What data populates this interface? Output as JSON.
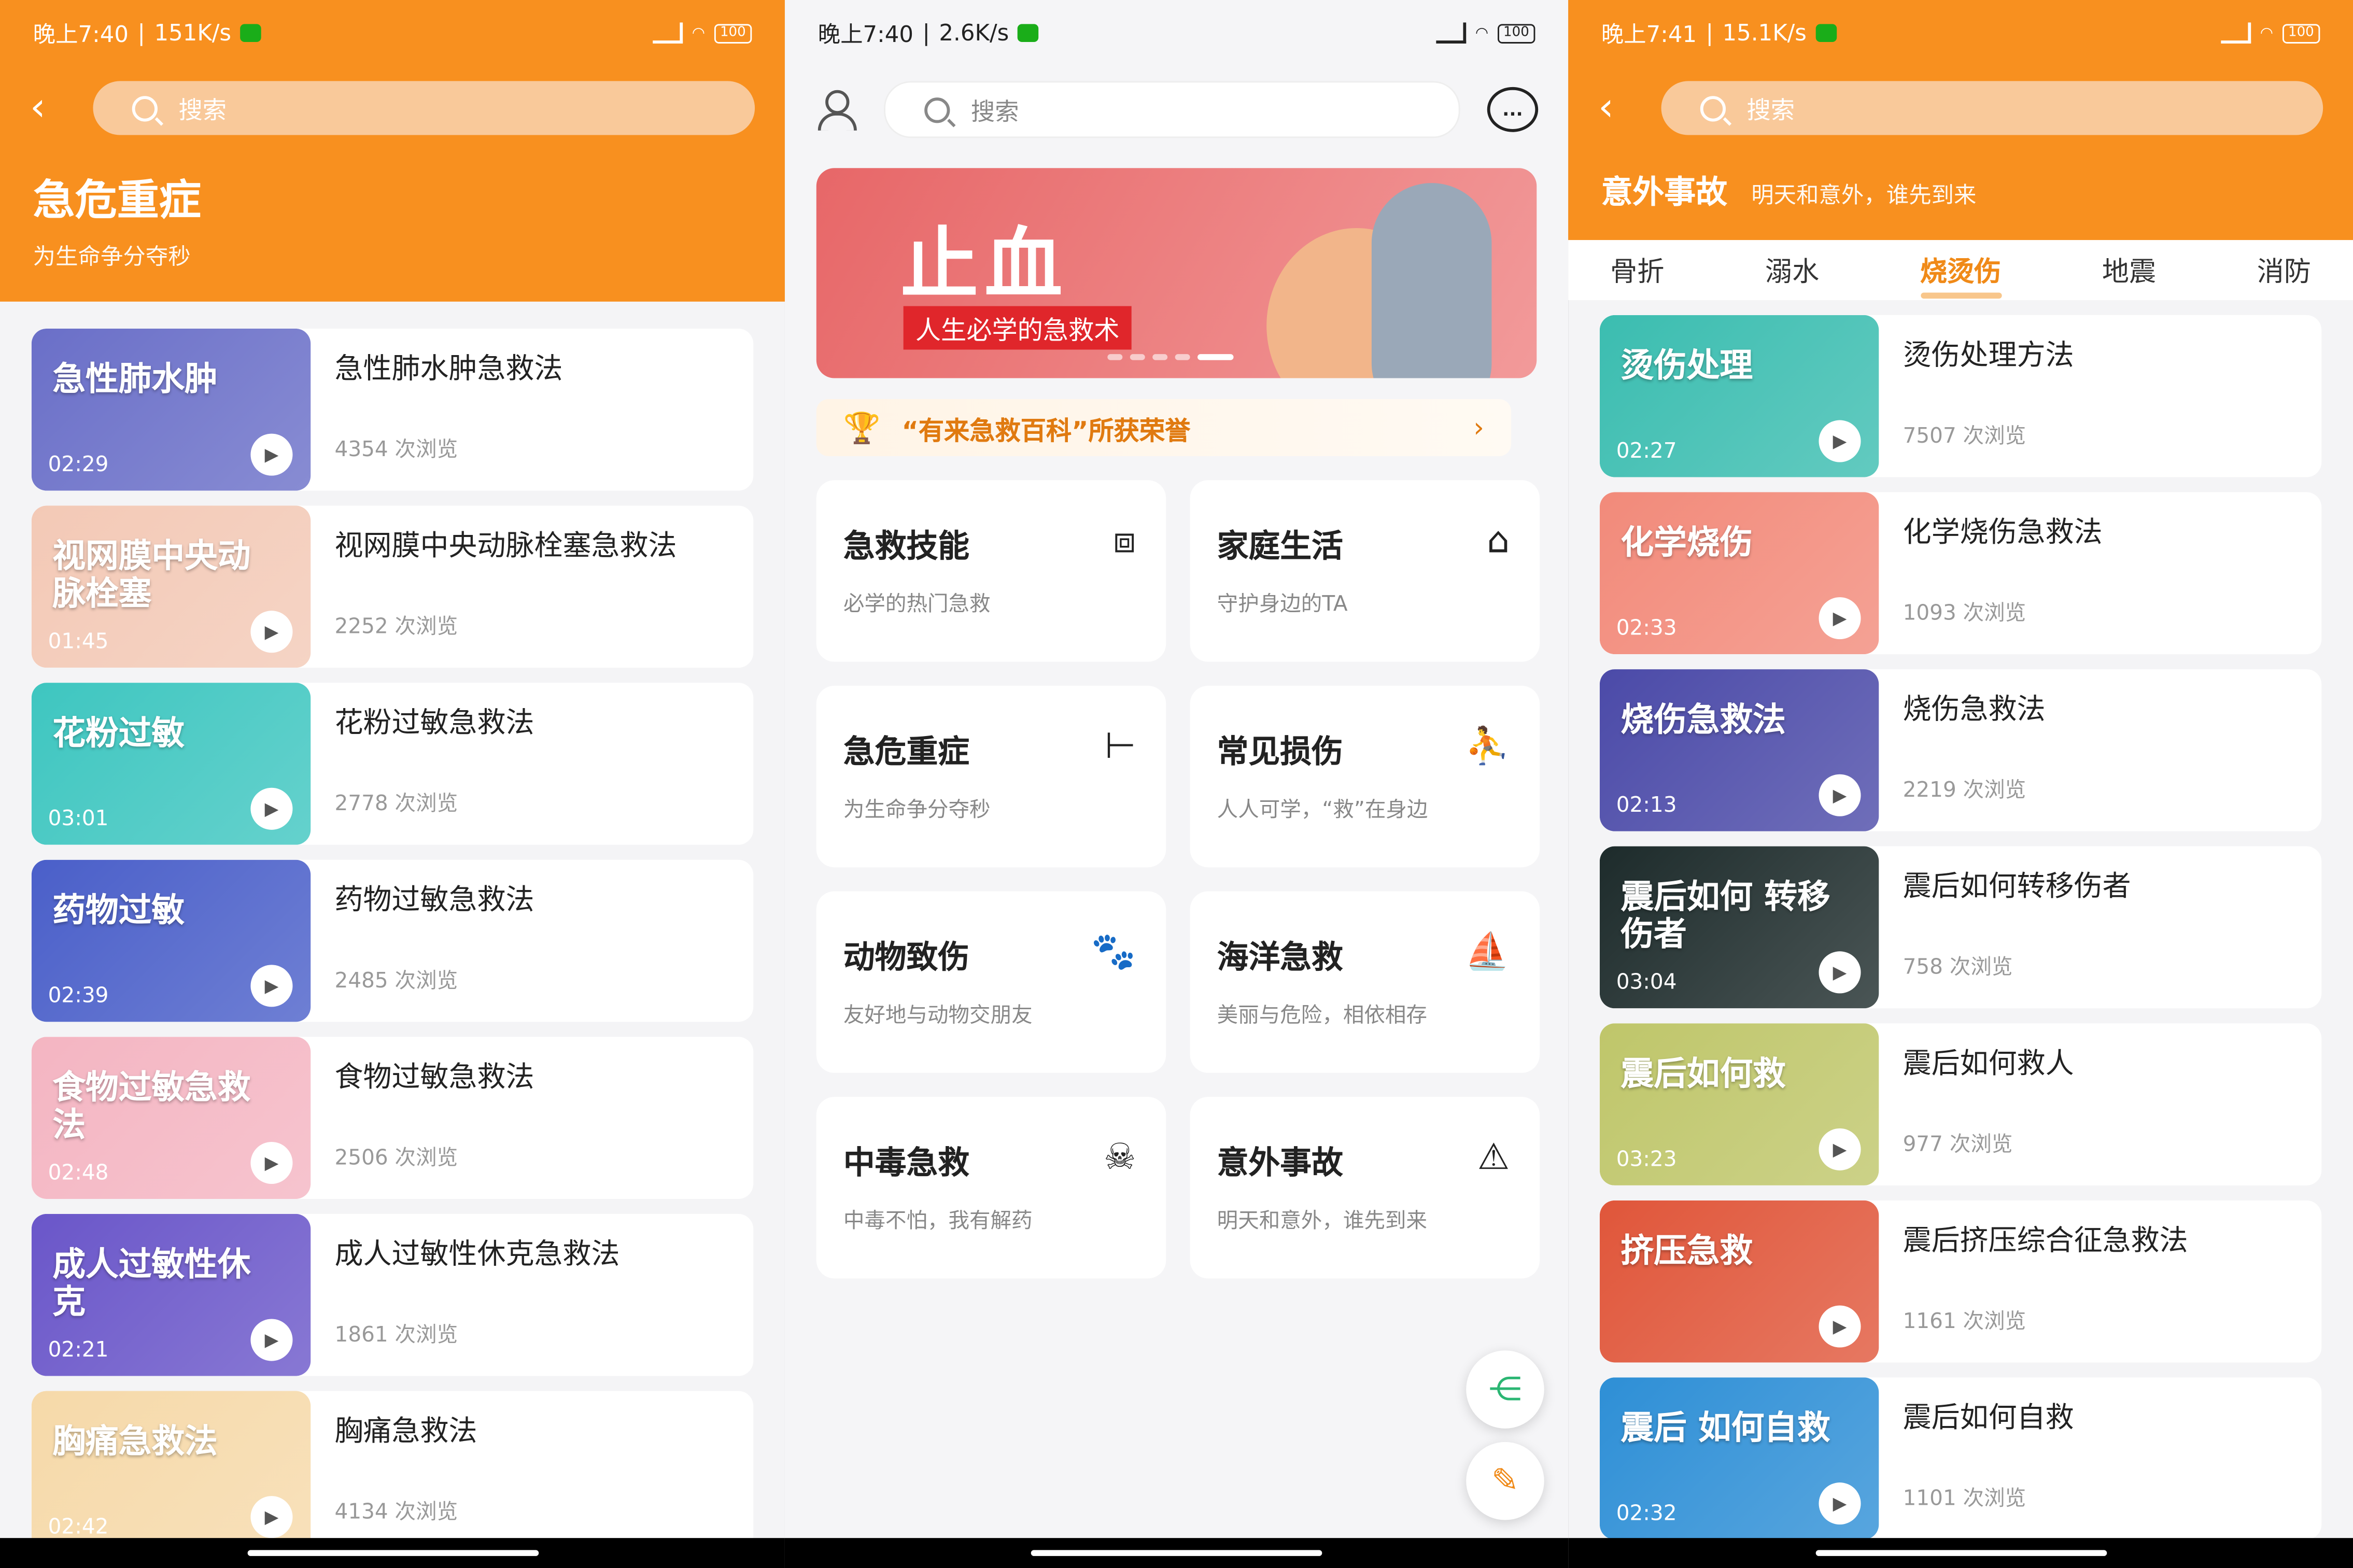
{
  "colors": {
    "accent": "#f8901f",
    "text": "#222222",
    "muted": "#999999"
  },
  "left": {
    "status": {
      "time": "晚上7:40",
      "speed": "151K/s",
      "battery": "100"
    },
    "search_placeholder": "搜索",
    "title": "急危重症",
    "subtitle": "为生命争分夺秒",
    "videos": [
      {
        "thumb_text": "急性肺水肿",
        "duration": "02:29",
        "title": "急性肺水肿急救法",
        "views": "4354 次浏览",
        "color": "#6a6fc8"
      },
      {
        "thumb_text": "视网膜中央动脉栓塞",
        "duration": "01:45",
        "title": "视网膜中央动脉栓塞急救法",
        "views": "2252 次浏览",
        "color": "#f3c9b6"
      },
      {
        "thumb_text": "花粉过敏",
        "duration": "03:01",
        "title": "花粉过敏急救法",
        "views": "2778 次浏览",
        "color": "#3ec6c0"
      },
      {
        "thumb_text": "药物过敏",
        "duration": "02:39",
        "title": "药物过敏急救法",
        "views": "2485 次浏览",
        "color": "#4a5fc9"
      },
      {
        "thumb_text": "食物过敏急救法",
        "duration": "02:48",
        "title": "食物过敏急救法",
        "views": "2506 次浏览",
        "color": "#f4b5c2"
      },
      {
        "thumb_text": "成人过敏性休克",
        "duration": "02:21",
        "title": "成人过敏性休克急救法",
        "views": "1861 次浏览",
        "color": "#6a56c9"
      },
      {
        "thumb_text": "胸痛急救法",
        "duration": "02:42",
        "title": "胸痛急救法",
        "views": "4134 次浏览",
        "color": "#f6d9a9"
      }
    ]
  },
  "middle": {
    "status": {
      "time": "晚上7:40",
      "speed": "2.6K/s",
      "battery": "100"
    },
    "search_placeholder": "搜索",
    "msg_icon": "...",
    "banner_title": "止血",
    "banner_tag": "人生必学的急救术",
    "honor": "“有来急救百科”所获荣誉",
    "categories": [
      {
        "title": "急救技能",
        "sub": "必学的热门急救",
        "icon": "⧈"
      },
      {
        "title": "家庭生活",
        "sub": "守护身边的TA",
        "icon": "⌂"
      },
      {
        "title": "急危重症",
        "sub": "为生命争分夺秒",
        "icon": "⊢"
      },
      {
        "title": "常见损伤",
        "sub": "人人可学，“救”在身边",
        "icon": "⛹"
      },
      {
        "title": "动物致伤",
        "sub": "友好地与动物交朋友",
        "icon": "🐾"
      },
      {
        "title": "海洋急救",
        "sub": "美丽与危险，相依相存",
        "icon": "⛵"
      },
      {
        "title": "中毒急救",
        "sub": "中毒不怕，我有解药",
        "icon": "☠"
      },
      {
        "title": "意外事故",
        "sub": "明天和意外，谁先到来",
        "icon": "⚠"
      }
    ]
  },
  "right": {
    "status": {
      "time": "晚上7:41",
      "speed": "15.1K/s",
      "battery": "100"
    },
    "search_placeholder": "搜索",
    "title": "意外事故",
    "subtitle": "明天和意外，谁先到来",
    "tabs": [
      "骨折",
      "溺水",
      "烧烫伤",
      "地震",
      "消防"
    ],
    "active_tab": "烧烫伤",
    "videos": [
      {
        "thumb_text": "烫伤处理",
        "duration": "02:27",
        "title": "烫伤处理方法",
        "views": "7507 次浏览",
        "color": "#3bbdb0"
      },
      {
        "thumb_text": "化学烧伤",
        "duration": "02:33",
        "title": "化学烧伤急救法",
        "views": "1093 次浏览",
        "color": "#f28a7a"
      },
      {
        "thumb_text": "烧伤急救法",
        "duration": "02:13",
        "title": "烧伤急救法",
        "views": "2219 次浏览",
        "color": "#4b4aa8"
      },
      {
        "thumb_text": "震后如何 转移伤者",
        "duration": "03:04",
        "title": "震后如何转移伤者",
        "views": "758 次浏览",
        "color": "#1d2b2b"
      },
      {
        "thumb_text": "震后如何救",
        "duration": "03:23",
        "title": "震后如何救人",
        "views": "977 次浏览",
        "color": "#bfc66a"
      },
      {
        "thumb_text": "挤压急救",
        "duration": "",
        "title": "震后挤压综合征急救法",
        "views": "1161 次浏览",
        "color": "#e0563a"
      },
      {
        "thumb_text": "震后 如何自救",
        "duration": "02:32",
        "title": "震后如何自救",
        "views": "1101 次浏览",
        "color": "#2e8fd6"
      }
    ]
  }
}
